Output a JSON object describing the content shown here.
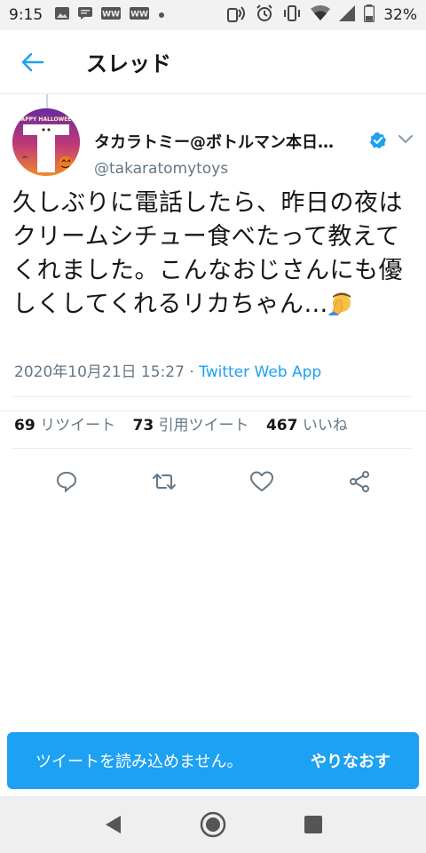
{
  "status_bar": {
    "time": "9:15",
    "battery": "32%"
  },
  "header": {
    "title": "スレッド"
  },
  "tweet": {
    "display_name": "タカラトミー@ボトルマン本日…",
    "handle": "@takaratomytoys",
    "text": "久しぶりに電話したら、昨日の夜はクリームシチュー食べたって教えてくれました。こんなおじさんにも優しくしてくれるリカちゃん…",
    "timestamp": "2020年10月21日 15:27 · ",
    "source": "Twitter Web App",
    "avatar_text": "HAPPY HALLOWEEN",
    "stats": {
      "retweets_count": "69",
      "retweets_label": "リツイート",
      "quotes_count": "73",
      "quotes_label": "引用ツイート",
      "likes_count": "467",
      "likes_label": "いいね"
    }
  },
  "toast": {
    "message": "ツイートを読み込めません。",
    "retry_label": "やりなおす"
  },
  "colors": {
    "accent": "#1da1f2",
    "text_primary": "#14171a",
    "text_secondary": "#657786"
  }
}
